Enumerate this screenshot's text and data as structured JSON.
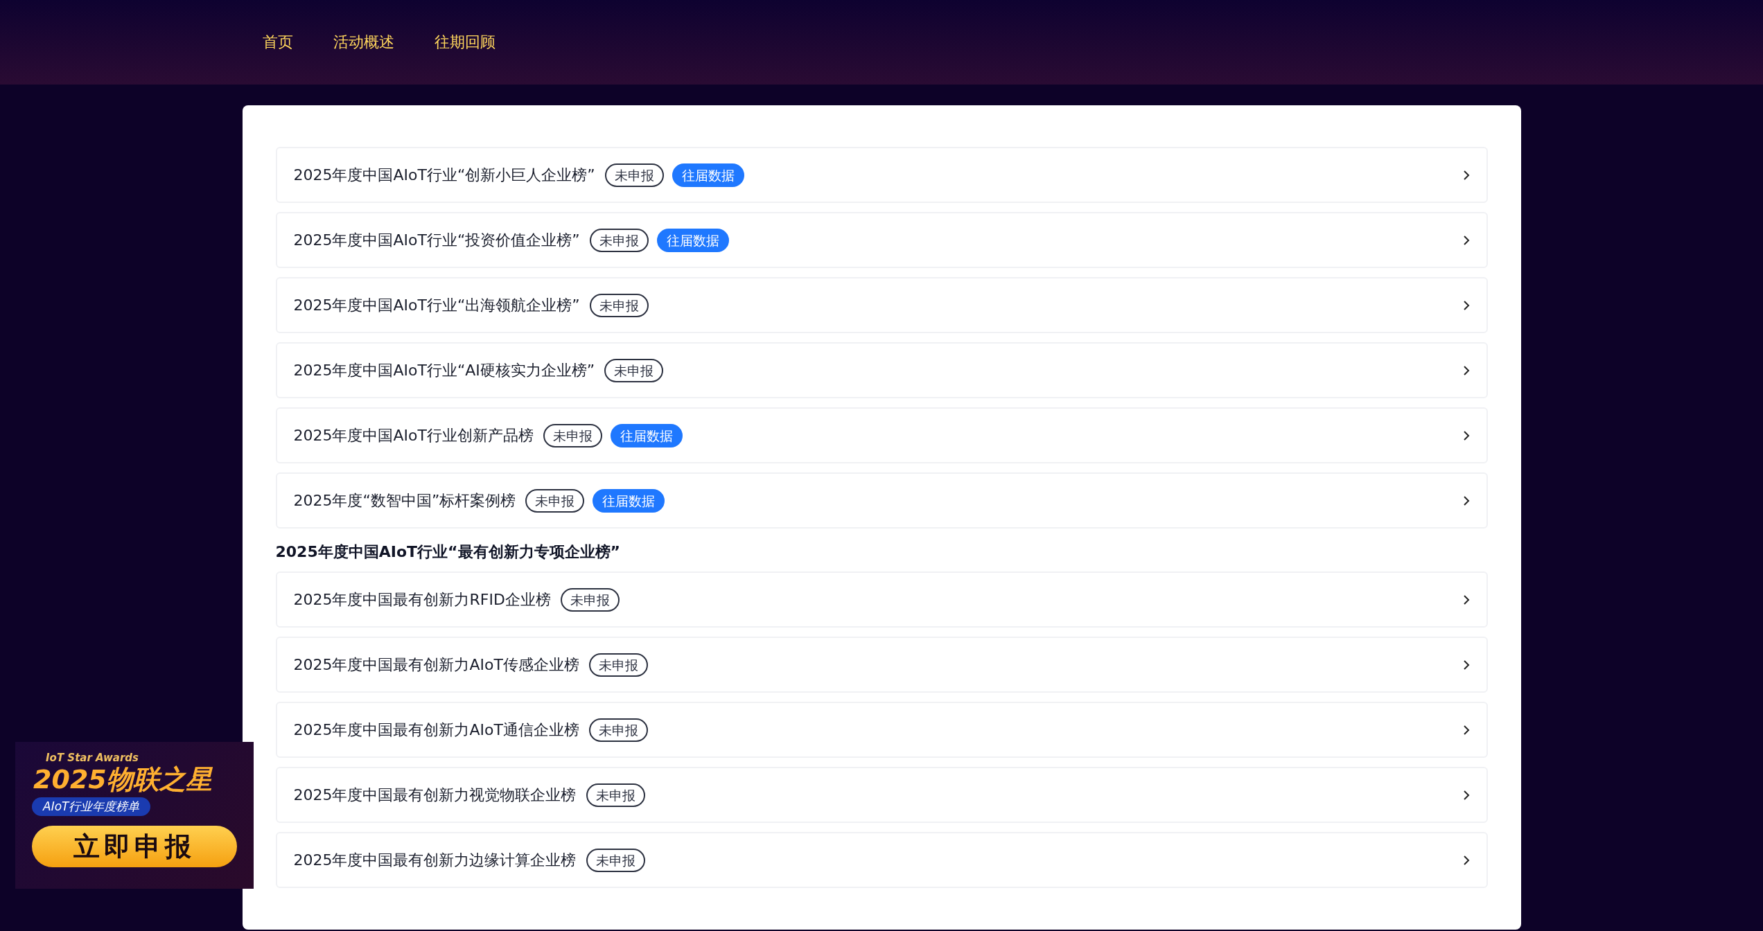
{
  "nav": [
    {
      "label": "首页"
    },
    {
      "label": "活动概述"
    },
    {
      "label": "往期回顾"
    }
  ],
  "sections": [
    {
      "items": [
        {
          "title": "2025年度中国AIoT行业“创新小巨人企业榜”",
          "badges": [
            {
              "kind": "outline",
              "text": "未申报"
            },
            {
              "kind": "filled",
              "text": "往届数据"
            }
          ]
        },
        {
          "title": "2025年度中国AIoT行业“投资价值企业榜”",
          "badges": [
            {
              "kind": "outline",
              "text": "未申报"
            },
            {
              "kind": "filled",
              "text": "往届数据"
            }
          ]
        },
        {
          "title": "2025年度中国AIoT行业“出海领航企业榜”",
          "badges": [
            {
              "kind": "outline",
              "text": "未申报"
            }
          ]
        },
        {
          "title": "2025年度中国AIoT行业“AI硬核实力企业榜”",
          "badges": [
            {
              "kind": "outline",
              "text": "未申报"
            }
          ]
        },
        {
          "title": "2025年度中国AIoT行业创新产品榜",
          "badges": [
            {
              "kind": "outline",
              "text": "未申报"
            },
            {
              "kind": "filled",
              "text": "往届数据"
            }
          ]
        },
        {
          "title": "2025年度“数智中国”标杆案例榜",
          "badges": [
            {
              "kind": "outline",
              "text": "未申报"
            },
            {
              "kind": "filled",
              "text": "往届数据"
            }
          ]
        }
      ]
    },
    {
      "heading": "2025年度中国AIoT行业“最有创新力专项企业榜”",
      "items": [
        {
          "title": "2025年度中国最有创新力RFID企业榜",
          "badges": [
            {
              "kind": "outline",
              "text": "未申报"
            }
          ]
        },
        {
          "title": "2025年度中国最有创新力AIoT传感企业榜",
          "badges": [
            {
              "kind": "outline",
              "text": "未申报"
            }
          ]
        },
        {
          "title": "2025年度中国最有创新力AIoT通信企业榜",
          "badges": [
            {
              "kind": "outline",
              "text": "未申报"
            }
          ]
        },
        {
          "title": "2025年度中国最有创新力视觉物联企业榜",
          "badges": [
            {
              "kind": "outline",
              "text": "未申报"
            }
          ]
        },
        {
          "title": "2025年度中国最有创新力边缘计算企业榜",
          "badges": [
            {
              "kind": "outline",
              "text": "未申报"
            }
          ]
        }
      ]
    }
  ],
  "promo": {
    "subtitle": "IoT Star Awards",
    "title": "2025物联之星",
    "tag": "AIoT行业年度榜单",
    "button": "立即申报"
  }
}
